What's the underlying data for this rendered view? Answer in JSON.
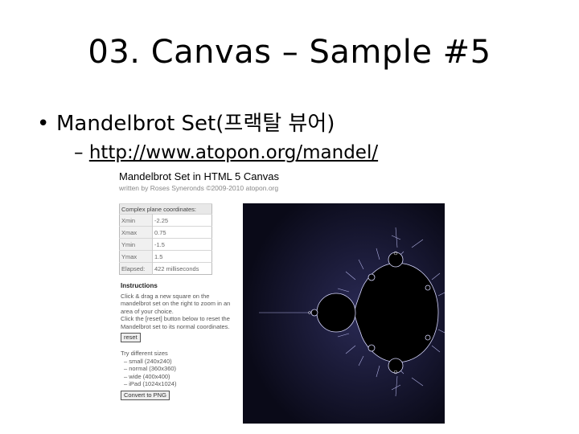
{
  "slide": {
    "title": "03. Canvas – Sample #5",
    "bullet": "Mandelbrot Set(프랙탈 뷰어)",
    "sub_dash": "–",
    "link": "http://www.atopon.org/mandel/"
  },
  "shot": {
    "title": "Mandelbrot Set in HTML 5 Canvas",
    "subtitle": "written by Roses Syneronds ©2009-2010 atopon.org",
    "coords_header": "Complex plane coordinates:",
    "coords": [
      {
        "label": "Xmin",
        "value": "-2.25"
      },
      {
        "label": "Xmax",
        "value": "0.75"
      },
      {
        "label": "Ymin",
        "value": "-1.5"
      },
      {
        "label": "Ymax",
        "value": "1.5"
      },
      {
        "label": "Elapsed:",
        "value": "422 milliseconds"
      }
    ],
    "instructions_heading": "Instructions",
    "instr_text1": "Click & drag a new square on the mandelbrot set on the right to zoom in an area of your choice.",
    "instr_text2": "Click the [reset] button below to reset the Mandelbrot set to its normal coordinates.",
    "reset_label": "reset",
    "sizes_heading": "Try different sizes",
    "sizes": [
      "– small (240x240)",
      "– normal (360x360)",
      "– wide (400x400)",
      "– iPad (1024x1024)"
    ],
    "png_label": "Convert to PNG"
  },
  "colors": {
    "fractal_bg": "#0c0c1e",
    "fractal_set": "#000000",
    "fractal_edge": "#c8c8ff"
  }
}
